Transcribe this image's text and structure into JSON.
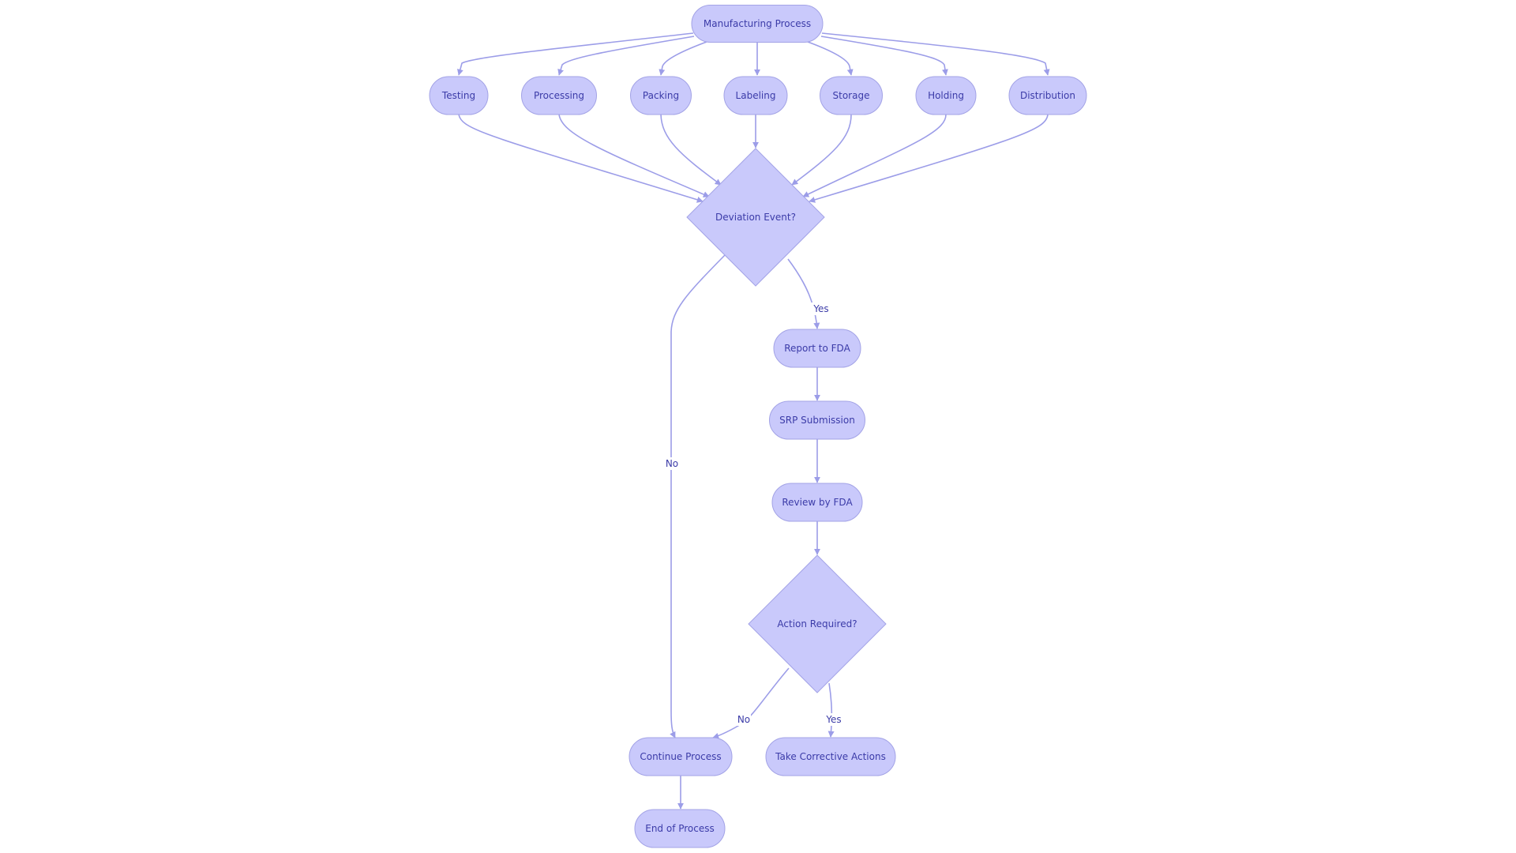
{
  "diagram": {
    "type": "flowchart",
    "colors": {
      "node_fill": "#c9c9fb",
      "node_stroke": "#a3a3e6",
      "text": "#3b3ba8",
      "edge": "#9c9de8"
    },
    "nodes": [
      {
        "id": "mfg",
        "label": "Manufacturing Process",
        "shape": "stadium"
      },
      {
        "id": "testing",
        "label": "Testing",
        "shape": "stadium"
      },
      {
        "id": "processing",
        "label": "Processing",
        "shape": "stadium"
      },
      {
        "id": "packing",
        "label": "Packing",
        "shape": "stadium"
      },
      {
        "id": "labeling",
        "label": "Labeling",
        "shape": "stadium"
      },
      {
        "id": "storage",
        "label": "Storage",
        "shape": "stadium"
      },
      {
        "id": "holding",
        "label": "Holding",
        "shape": "stadium"
      },
      {
        "id": "distribution",
        "label": "Distribution",
        "shape": "stadium"
      },
      {
        "id": "deviation",
        "label": "Deviation Event?",
        "shape": "diamond"
      },
      {
        "id": "report",
        "label": "Report to FDA",
        "shape": "stadium"
      },
      {
        "id": "srp",
        "label": "SRP Submission",
        "shape": "stadium"
      },
      {
        "id": "review",
        "label": "Review by FDA",
        "shape": "stadium"
      },
      {
        "id": "action",
        "label": "Action Required?",
        "shape": "diamond"
      },
      {
        "id": "continue",
        "label": "Continue Process",
        "shape": "stadium"
      },
      {
        "id": "corrective",
        "label": "Take Corrective Actions",
        "shape": "stadium"
      },
      {
        "id": "end",
        "label": "End of Process",
        "shape": "stadium"
      }
    ],
    "edges": [
      {
        "from": "mfg",
        "to": "testing",
        "label": ""
      },
      {
        "from": "mfg",
        "to": "processing",
        "label": ""
      },
      {
        "from": "mfg",
        "to": "packing",
        "label": ""
      },
      {
        "from": "mfg",
        "to": "labeling",
        "label": ""
      },
      {
        "from": "mfg",
        "to": "storage",
        "label": ""
      },
      {
        "from": "mfg",
        "to": "holding",
        "label": ""
      },
      {
        "from": "mfg",
        "to": "distribution",
        "label": ""
      },
      {
        "from": "testing",
        "to": "deviation",
        "label": ""
      },
      {
        "from": "processing",
        "to": "deviation",
        "label": ""
      },
      {
        "from": "packing",
        "to": "deviation",
        "label": ""
      },
      {
        "from": "labeling",
        "to": "deviation",
        "label": ""
      },
      {
        "from": "storage",
        "to": "deviation",
        "label": ""
      },
      {
        "from": "holding",
        "to": "deviation",
        "label": ""
      },
      {
        "from": "distribution",
        "to": "deviation",
        "label": ""
      },
      {
        "from": "deviation",
        "to": "report",
        "label": "Yes"
      },
      {
        "from": "deviation",
        "to": "continue",
        "label": "No"
      },
      {
        "from": "report",
        "to": "srp",
        "label": ""
      },
      {
        "from": "srp",
        "to": "review",
        "label": ""
      },
      {
        "from": "review",
        "to": "action",
        "label": ""
      },
      {
        "from": "action",
        "to": "corrective",
        "label": "Yes"
      },
      {
        "from": "action",
        "to": "continue",
        "label": "No"
      },
      {
        "from": "continue",
        "to": "end",
        "label": ""
      }
    ]
  }
}
